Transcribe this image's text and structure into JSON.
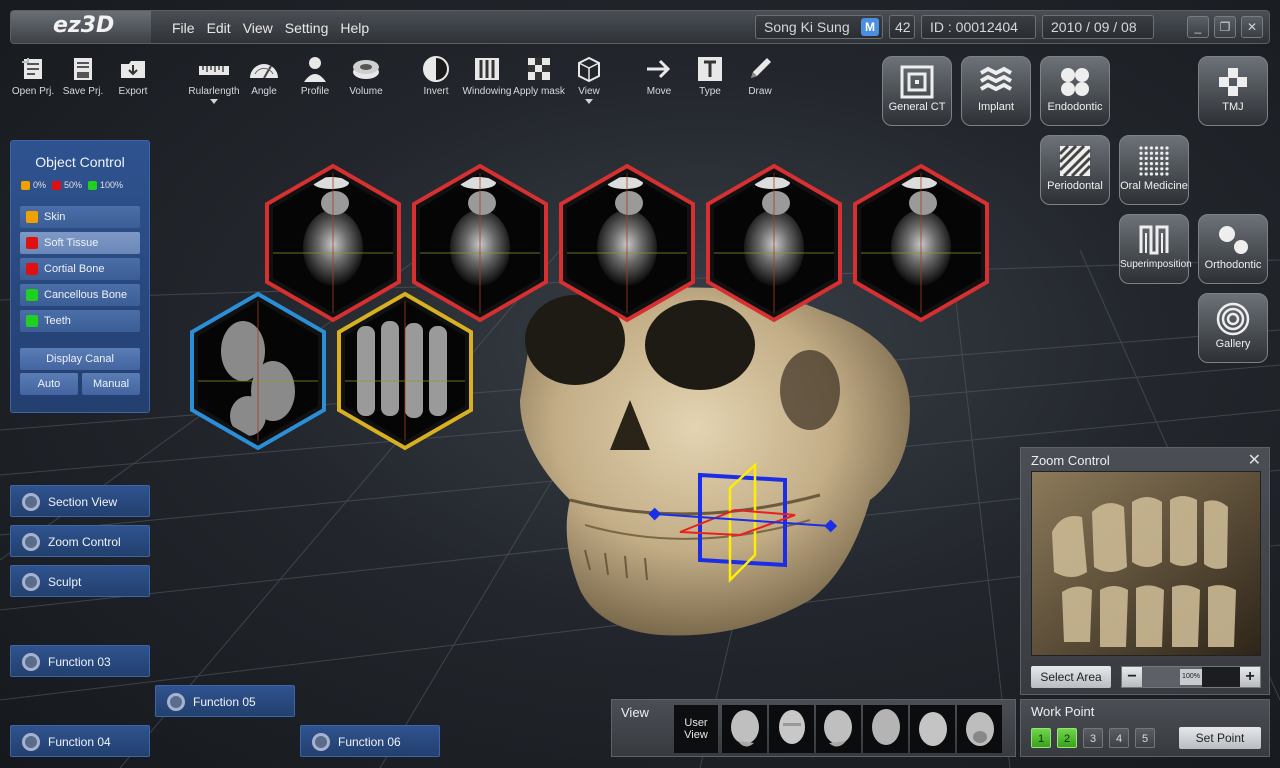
{
  "app": {
    "logo": "ez3D"
  },
  "menu": [
    "File",
    "Edit",
    "View",
    "Setting",
    "Help"
  ],
  "user": {
    "name": "Song Ki Sung",
    "badge": "M",
    "age": "42",
    "id": "ID : 00012404",
    "date": "2010 / 09 / 08"
  },
  "toolbar": {
    "open": "Open Prj.",
    "save": "Save Prj.",
    "export": "Export",
    "ruler": "Rularlength",
    "angle": "Angle",
    "profile": "Profile",
    "volume": "Volume",
    "invert": "Invert",
    "windowing": "Windowing",
    "apply_mask": "Apply mask",
    "view": "View",
    "move": "Move",
    "type": "Type",
    "draw": "Draw"
  },
  "modules": {
    "general_ct": "General CT",
    "implant": "Implant",
    "endodontic": "Endodontic",
    "tmj": "TMJ",
    "periodontal": "Periodontal",
    "oral_medicine": "Oral Medicine",
    "superimposition": "Superimposition",
    "orthodontic": "Orthodontic",
    "gallery": "Gallery"
  },
  "object_control": {
    "title": "Object Control",
    "legend": [
      {
        "label": "0%",
        "color": "#f0a000"
      },
      {
        "label": "50%",
        "color": "#e01010"
      },
      {
        "label": "100%",
        "color": "#20d020"
      }
    ],
    "layers": [
      {
        "label": "Skin",
        "color": "#f0a000"
      },
      {
        "label": "Soft Tissue",
        "color": "#e01010"
      },
      {
        "label": "Cortial Bone",
        "color": "#e01010"
      },
      {
        "label": "Cancellous Bone",
        "color": "#20d020"
      },
      {
        "label": "Teeth",
        "color": "#20d020"
      }
    ],
    "display_canal": "Display Canal",
    "auto": "Auto",
    "manual": "Manual"
  },
  "functions": {
    "section_view": "Section View",
    "zoom_control": "Zoom Control",
    "sculpt": "Sculpt",
    "f03": "Function 03",
    "f04": "Function 04",
    "f05": "Function 05",
    "f06": "Function 06"
  },
  "zoom": {
    "title": "Zoom Control",
    "close": "✕",
    "select_area": "Select Area",
    "value": "100%",
    "minus": "−",
    "plus": "+"
  },
  "view_bar": {
    "title": "View",
    "user_view": "User View"
  },
  "work_point": {
    "title": "Work Point",
    "points": [
      "1",
      "2",
      "3",
      "4",
      "5"
    ],
    "active": [
      true,
      true,
      false,
      false,
      false
    ],
    "set_point": "Set Point"
  },
  "colors": {
    "panel_blue": "#2f5390",
    "hex_red": "#d83030",
    "hex_blue": "#2b8fd8",
    "hex_yellow": "#d8b020"
  }
}
